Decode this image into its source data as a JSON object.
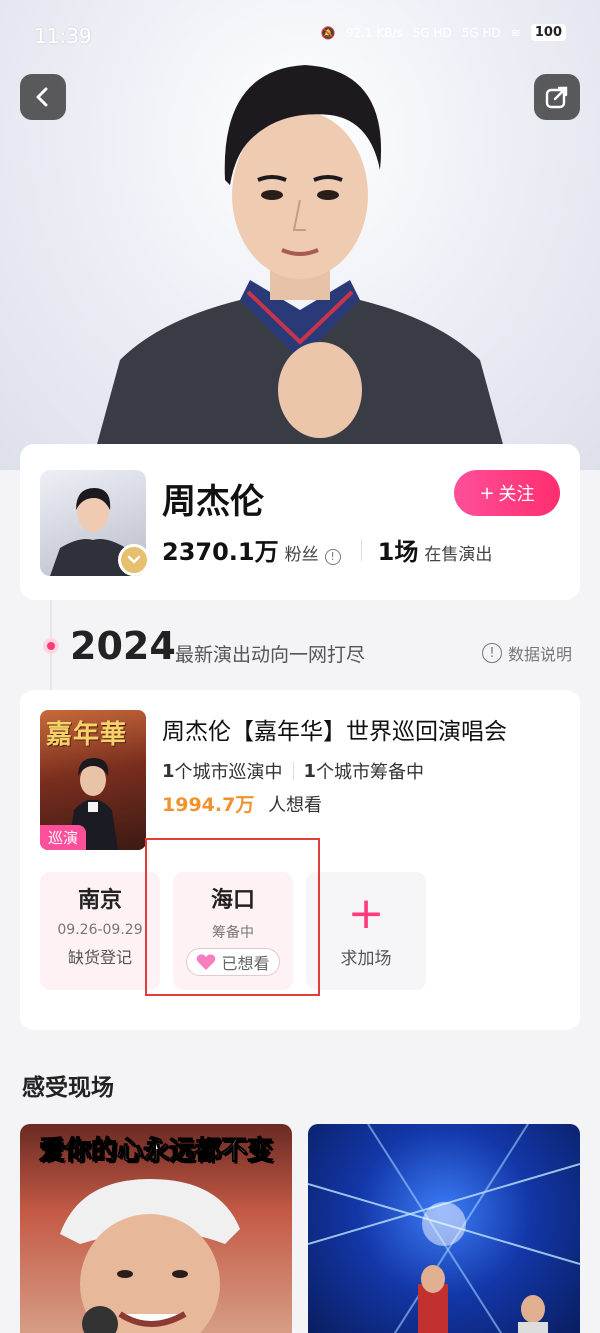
{
  "status": {
    "time": "11:39",
    "network_speed": "92.1 KB/s",
    "signal1": "5G HD",
    "signal2": "5G HD",
    "battery": "100"
  },
  "icons": {
    "back": "chevron-left-icon",
    "share": "share-icon",
    "verified": "chevron-down-badge-icon",
    "info": "info-icon",
    "heart": "heart-icon",
    "plus": "plus-icon"
  },
  "artist": {
    "name": "周杰伦",
    "follow_label": "关注",
    "follow_plus": "+",
    "fans_count": "2370.1万",
    "fans_label": "粉丝",
    "shows_count": "1场",
    "shows_label": "在售演出"
  },
  "timeline": {
    "year": "2024",
    "subtitle": "最新演出动向一网打尽",
    "data_note": "数据说明"
  },
  "tour": {
    "poster_title": "嘉年華",
    "poster_tag": "巡演",
    "title": "周杰伦【嘉年华】世界巡回演唱会",
    "touring_num": "1",
    "touring_label": "个城市巡演中",
    "planning_num": "1",
    "planning_label": "个城市筹备中",
    "want_count": "1994.7万",
    "want_label": "人想看",
    "cities": [
      {
        "name": "南京",
        "date": "09.26-09.29",
        "status": "缺货登记"
      },
      {
        "name": "海口",
        "status": "筹备中",
        "want_label": "已想看"
      }
    ],
    "add_label": "求加场"
  },
  "live_section": {
    "title": "感受现场",
    "video1_caption": "爱你的心永远都不变"
  },
  "colors": {
    "accent_pink": "#ff3b7a",
    "orange": "#f0922e",
    "highlight_red": "#e53b3b"
  }
}
